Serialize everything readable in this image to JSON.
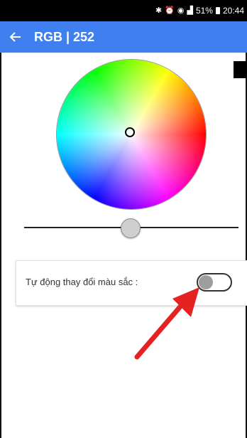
{
  "status_bar": {
    "bluetooth_icon": "bluetooth-icon",
    "alarm_icon": "alarm-icon",
    "wifi_icon": "wifi-icon",
    "signal_icon": "signal-icon",
    "battery": "51%",
    "time": "20:44"
  },
  "app_bar": {
    "back_icon": "back-arrow-icon",
    "title": "RGB | 252",
    "color": "#3f7ff0"
  },
  "color_picker": {
    "current_color": "#000000"
  },
  "brightness_slider": {
    "value": 0.49
  },
  "auto_color": {
    "label": "Tự động thay đổi màu sắc :",
    "enabled": false
  },
  "annotation": {
    "arrow_color": "#e52222"
  }
}
